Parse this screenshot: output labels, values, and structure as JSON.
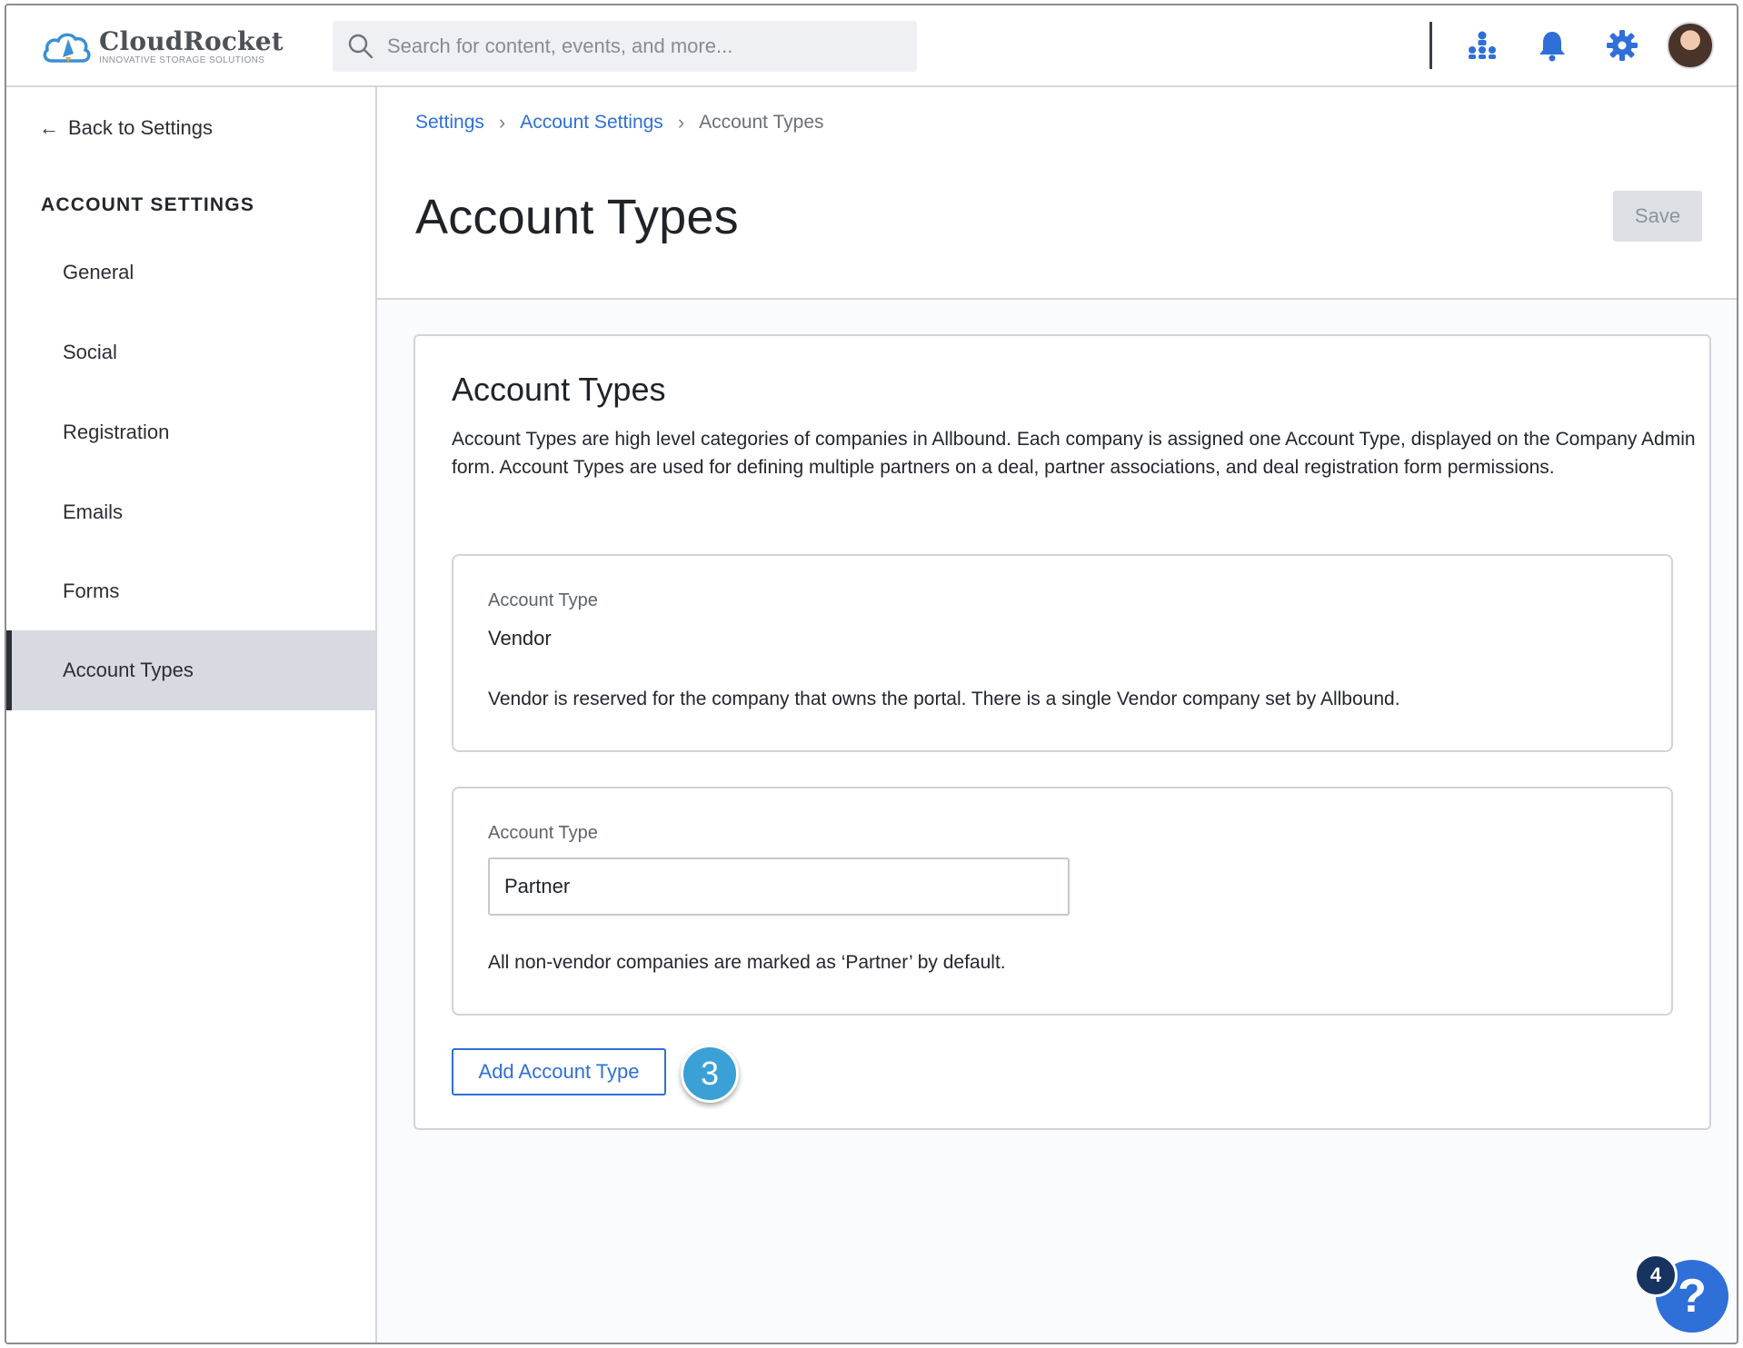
{
  "app": {
    "brand_name": "CloudRocket",
    "brand_tagline": "INNOVATIVE STORAGE SOLUTIONS"
  },
  "search": {
    "placeholder": "Search for content, events, and more...",
    "value": ""
  },
  "topbar": {
    "icons": [
      "org-chart-icon",
      "bell-icon",
      "gear-icon"
    ],
    "accent_color": "#2e6fd8"
  },
  "sidebar": {
    "back_label": "Back to Settings",
    "heading": "ACCOUNT SETTINGS",
    "items": [
      {
        "label": "General",
        "active": false
      },
      {
        "label": "Social",
        "active": false
      },
      {
        "label": "Registration",
        "active": false
      },
      {
        "label": "Emails",
        "active": false
      },
      {
        "label": "Forms",
        "active": false
      },
      {
        "label": "Account Types",
        "active": true
      }
    ]
  },
  "breadcrumb": {
    "items": [
      "Settings",
      "Account Settings"
    ],
    "current": "Account Types"
  },
  "header": {
    "title": "Account Types",
    "save_label": "Save"
  },
  "card": {
    "title": "Account Types",
    "description": "Account Types are high level categories of companies in Allbound. Each company is assigned one Account Type, displayed on the Company Admin form. Account Types are used for defining multiple partners on a deal, partner associations, and deal registration form permissions.",
    "vendor": {
      "label": "Account Type",
      "value": "Vendor",
      "help": "Vendor is reserved for the company that owns the portal. There is a single Vendor company set by Allbound."
    },
    "partner": {
      "label": "Account Type",
      "value": "Partner",
      "help": "All non-vendor companies are marked as ‘Partner’ by default."
    },
    "add_label": "Add Account Type",
    "step_badge": "3"
  },
  "help_widget": {
    "icon": "?",
    "count": "4"
  }
}
